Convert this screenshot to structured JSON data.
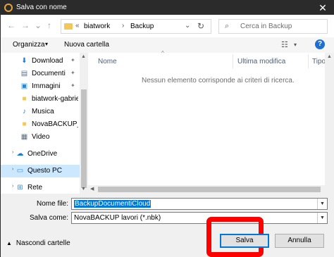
{
  "window": {
    "title": "Salva con nome",
    "close_glyph": "✕"
  },
  "nav": {
    "back_glyph": "←",
    "forward_glyph": "→",
    "recent_glyph": "⌄",
    "up_glyph": "↑",
    "address": {
      "chev": "«",
      "crumbs": [
        "biatwork",
        "Backup"
      ],
      "sep": "›",
      "dd": "⌄",
      "refresh": "↻"
    },
    "search": {
      "placeholder": "Cerca in Backup",
      "icon": "⌕"
    }
  },
  "toolbar": {
    "organize": "Organizza",
    "new_folder": "Nuova cartella",
    "caret": "▾",
    "view_glyph": "☷",
    "help_glyph": "?"
  },
  "sidebar": {
    "items": [
      {
        "label": "Download",
        "icon": "download-icon",
        "glyph": "⬇",
        "pinned": true
      },
      {
        "label": "Documenti",
        "icon": "documents-icon",
        "glyph": "▤",
        "pinned": true
      },
      {
        "label": "Immagini",
        "icon": "pictures-icon",
        "glyph": "▣",
        "pinned": true
      },
      {
        "label": "biatwork-gabriel",
        "icon": "folder-icon",
        "glyph": "■",
        "pinned": false
      },
      {
        "label": "Musica",
        "icon": "music-icon",
        "glyph": "♪",
        "pinned": false
      },
      {
        "label": "NovaBACKUP_C",
        "icon": "folder-icon",
        "glyph": "■",
        "pinned": false
      },
      {
        "label": "Video",
        "icon": "video-icon",
        "glyph": "▦",
        "pinned": false
      },
      {
        "label": "OneDrive",
        "icon": "onedrive-icon",
        "glyph": "☁",
        "pinned": false
      },
      {
        "label": "Questo PC",
        "icon": "computer-icon",
        "glyph": "▭",
        "pinned": false
      },
      {
        "label": "Rete",
        "icon": "network-icon",
        "glyph": "⊞",
        "pinned": false
      }
    ],
    "pin_glyph": "✦",
    "expand_glyph": "›"
  },
  "list": {
    "columns": [
      "Nome",
      "Ultima modifica",
      "Tipo"
    ],
    "empty_message": "Nessun elemento corrisponde ai criteri di ricerca."
  },
  "form": {
    "filename_label": "Nome file:",
    "filename_value": "BackupDocumentiCloud",
    "savetype_label": "Salva come:",
    "savetype_value": "NovaBACKUP lavori (*.nbk)",
    "hide_folders": "Nascondi cartelle",
    "save_button": "Salva",
    "cancel_button": "Annulla"
  },
  "colors": {
    "highlight": "#ff0000",
    "accent": "#0078d7"
  }
}
